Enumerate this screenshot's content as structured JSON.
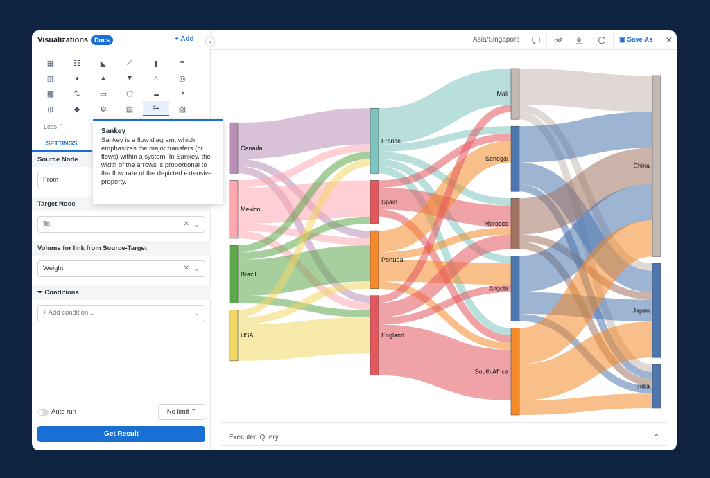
{
  "sidebar": {
    "title": "Visualizations",
    "docs_badge": "Docs",
    "add_label": "Add",
    "icons": [
      "table-icon",
      "pivot-table-icon",
      "area-chart-icon",
      "line-chart-icon",
      "bar-chart-icon",
      "horizontal-bar-icon",
      "combo-chart-icon",
      "pie-chart-icon",
      "pyramid-icon",
      "funnel-icon",
      "scatter-icon",
      "geo-map-icon",
      "heatmap-icon",
      "sorted-bar-icon",
      "kpi-icon",
      "radar-icon",
      "word-cloud-icon",
      "gauge-icon",
      "sunburst-icon",
      "map-icon",
      "network-icon",
      "calendar-icon",
      "sankey-icon",
      "histogram-icon"
    ],
    "active_icon_index": 22,
    "less_label": "Less",
    "settings_tab": "SETTINGS",
    "source_node_label": "Source Node",
    "source_node_value": "From",
    "target_node_label": "Target Node",
    "target_node_value": "To",
    "volume_label": "Volume for link from Source-Target",
    "volume_value": "Weight",
    "conditions_label": "Conditions",
    "add_condition": "+ Add condition...",
    "auto_run_label": "Auto run",
    "limit_label": "No limit",
    "get_result_label": "Get Result"
  },
  "tooltip": {
    "title": "Sankey",
    "body": "Sankey is a flow diagram, which emphasizes the major transfers (or flows) within a system. In Sankey, the width of the arrows is proportional to the flow rate of the depicted extensive property."
  },
  "toolbar": {
    "timezone": "Asia/Singapore",
    "save_as_label": "Save As"
  },
  "executed_query_label": "Executed Query",
  "chart_data": {
    "type": "sankey",
    "nodes": [
      {
        "name": "Canada",
        "color": "#b98fb8"
      },
      {
        "name": "Mexico",
        "color": "#fda8b0"
      },
      {
        "name": "Brazil",
        "color": "#5ea84f"
      },
      {
        "name": "USA",
        "color": "#f1d764"
      },
      {
        "name": "France",
        "color": "#7fc4bf"
      },
      {
        "name": "Spain",
        "color": "#e4575c"
      },
      {
        "name": "Portugal",
        "color": "#f48a2a"
      },
      {
        "name": "England",
        "color": "#e4575c"
      },
      {
        "name": "Mali",
        "color": "#c4b8b2"
      },
      {
        "name": "Senegal",
        "color": "#4d77ae"
      },
      {
        "name": "Morocco",
        "color": "#a07563"
      },
      {
        "name": "Angola",
        "color": "#4d77ae"
      },
      {
        "name": "South Africa",
        "color": "#f48a2a"
      },
      {
        "name": "China",
        "color": "#c4b8b2"
      },
      {
        "name": "Japan",
        "color": "#4d77ae"
      },
      {
        "name": "India",
        "color": "#4d77ae"
      }
    ],
    "links": [
      {
        "source": "Canada",
        "target": "France",
        "value": 5
      },
      {
        "source": "Canada",
        "target": "Portugal",
        "value": 1
      },
      {
        "source": "Canada",
        "target": "England",
        "value": 1
      },
      {
        "source": "Mexico",
        "target": "France",
        "value": 1
      },
      {
        "source": "Mexico",
        "target": "Spain",
        "value": 5
      },
      {
        "source": "Mexico",
        "target": "Portugal",
        "value": 1
      },
      {
        "source": "Mexico",
        "target": "England",
        "value": 1
      },
      {
        "source": "Brazil",
        "target": "France",
        "value": 1
      },
      {
        "source": "Brazil",
        "target": "Spain",
        "value": 1
      },
      {
        "source": "Brazil",
        "target": "Portugal",
        "value": 5
      },
      {
        "source": "Brazil",
        "target": "England",
        "value": 1
      },
      {
        "source": "USA",
        "target": "France",
        "value": 1
      },
      {
        "source": "USA",
        "target": "Portugal",
        "value": 1
      },
      {
        "source": "USA",
        "target": "England",
        "value": 5
      },
      {
        "source": "France",
        "target": "Mali",
        "value": 5
      },
      {
        "source": "France",
        "target": "Senegal",
        "value": 1
      },
      {
        "source": "France",
        "target": "Morocco",
        "value": 1
      },
      {
        "source": "France",
        "target": "Angola",
        "value": 1
      },
      {
        "source": "France",
        "target": "South Africa",
        "value": 1
      },
      {
        "source": "Spain",
        "target": "Senegal",
        "value": 1
      },
      {
        "source": "Spain",
        "target": "Morocco",
        "value": 3
      },
      {
        "source": "Spain",
        "target": "South Africa",
        "value": 1
      },
      {
        "source": "Portugal",
        "target": "Senegal",
        "value": 3
      },
      {
        "source": "Portugal",
        "target": "Morocco",
        "value": 1
      },
      {
        "source": "Portugal",
        "target": "Angola",
        "value": 3
      },
      {
        "source": "Portugal",
        "target": "South Africa",
        "value": 1
      },
      {
        "source": "England",
        "target": "Mali",
        "value": 1
      },
      {
        "source": "England",
        "target": "Morocco",
        "value": 2
      },
      {
        "source": "England",
        "target": "Angola",
        "value": 1
      },
      {
        "source": "England",
        "target": "South Africa",
        "value": 7
      },
      {
        "source": "Mali",
        "target": "China",
        "value": 5
      },
      {
        "source": "Mali",
        "target": "Japan",
        "value": 1
      },
      {
        "source": "Mali",
        "target": "India",
        "value": 1
      },
      {
        "source": "Senegal",
        "target": "China",
        "value": 5
      },
      {
        "source": "Senegal",
        "target": "Japan",
        "value": 3
      },
      {
        "source": "Senegal",
        "target": "India",
        "value": 1
      },
      {
        "source": "Morocco",
        "target": "China",
        "value": 5
      },
      {
        "source": "Morocco",
        "target": "Japan",
        "value": 1
      },
      {
        "source": "Morocco",
        "target": "India",
        "value": 1
      },
      {
        "source": "Angola",
        "target": "China",
        "value": 5
      },
      {
        "source": "Angola",
        "target": "Japan",
        "value": 3
      },
      {
        "source": "Angola",
        "target": "India",
        "value": 1
      },
      {
        "source": "South Africa",
        "target": "China",
        "value": 5
      },
      {
        "source": "South Africa",
        "target": "Japan",
        "value": 5
      },
      {
        "source": "South Africa",
        "target": "India",
        "value": 2
      }
    ]
  }
}
